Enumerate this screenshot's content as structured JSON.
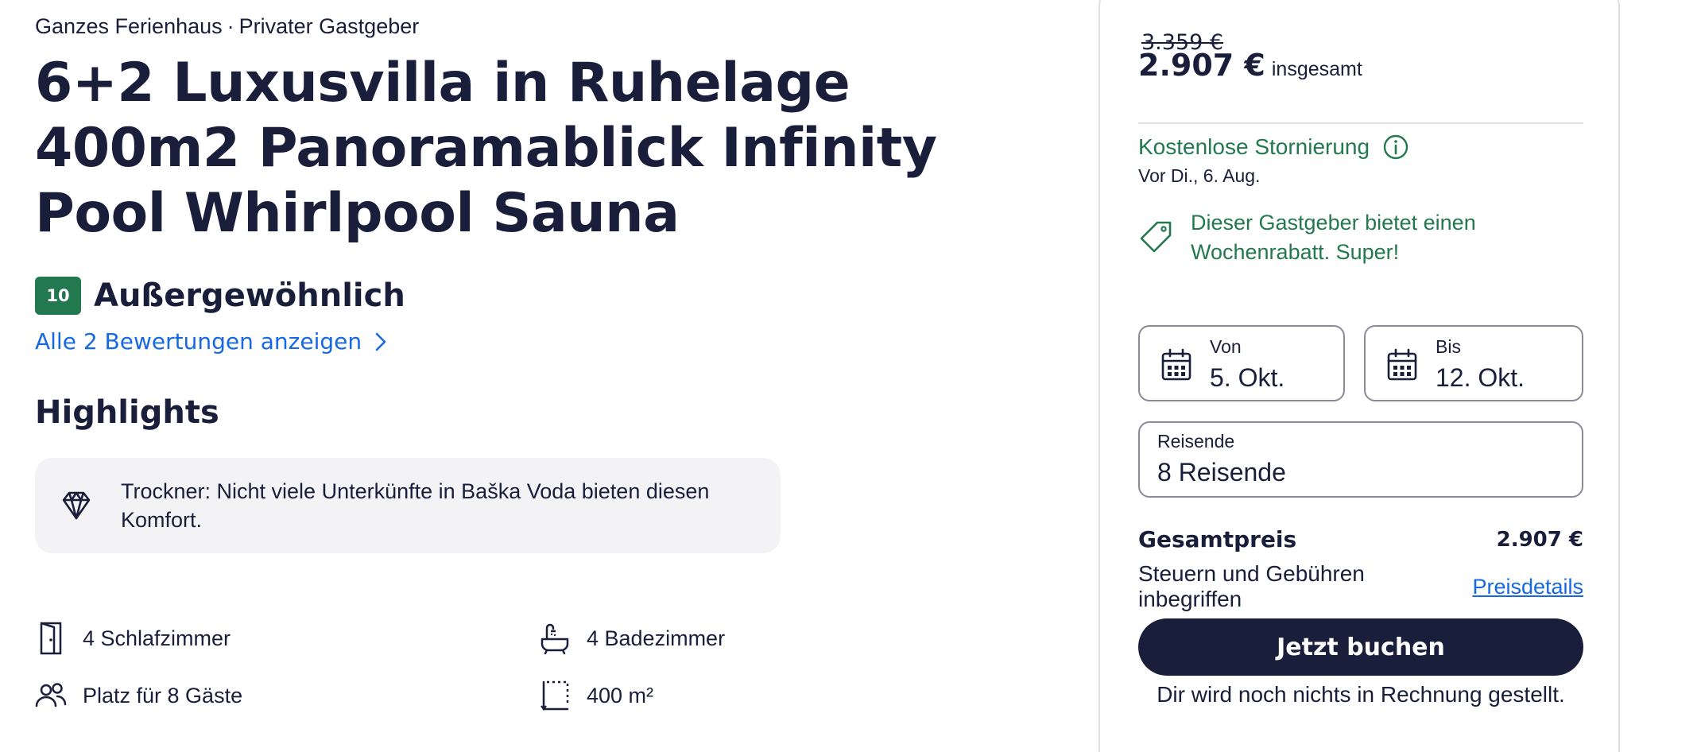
{
  "listing": {
    "type": "Ganzes Ferienhaus",
    "separator": "·",
    "host": "Privater Gastgeber",
    "title": "6+2 Luxusvilla in Ruhelage 400m2 Panoramablick Infinity Pool Whirlpool Sauna"
  },
  "rating": {
    "score": "10",
    "label": "Außergewöhnlich",
    "reviews_link": "Alle 2 Bewertungen anzeigen"
  },
  "highlights": {
    "heading": "Highlights",
    "items": [
      {
        "icon": "diamond-icon",
        "text": "Trockner: Nicht viele Unterkünfte in Baška Voda bieten diesen Komfort."
      }
    ]
  },
  "facts": [
    {
      "icon": "door-icon",
      "label": "4 Schlafzimmer"
    },
    {
      "icon": "bathtub-icon",
      "label": "4 Badezimmer"
    },
    {
      "icon": "guests-icon",
      "label": "Platz für 8 Gäste"
    },
    {
      "icon": "area-icon",
      "label": "400 m²"
    }
  ],
  "booking": {
    "old_price": "3.359 €",
    "price": "2.907 €",
    "price_suffix": "insgesamt",
    "cancellation_title": "Kostenlose Stornierung",
    "cancellation_date": "Vor Di., 6. Aug.",
    "discount_text": "Dieser Gastgeber bietet einen Wochenrabatt. Super!",
    "from_label": "Von",
    "from_value": "5. Okt.",
    "to_label": "Bis",
    "to_value": "12. Okt.",
    "travelers_label": "Reisende",
    "travelers_value": "8 Reisende",
    "total_label": "Gesamtpreis",
    "total_value": "2.907 €",
    "tax_text": "Steuern und Gebühren inbegriffen",
    "details_link": "Preisdetails",
    "book_button": "Jetzt buchen",
    "no_charge_text": "Dir wird noch nichts in Rechnung gestellt."
  },
  "colors": {
    "text": "#191e3b",
    "rating_badge": "#227950",
    "positive_green": "#227950",
    "link_blue": "#1668e3",
    "card_border": "#dfe0e4",
    "highlight_bg": "#f3f3f5",
    "button_bg": "#191e3b"
  }
}
